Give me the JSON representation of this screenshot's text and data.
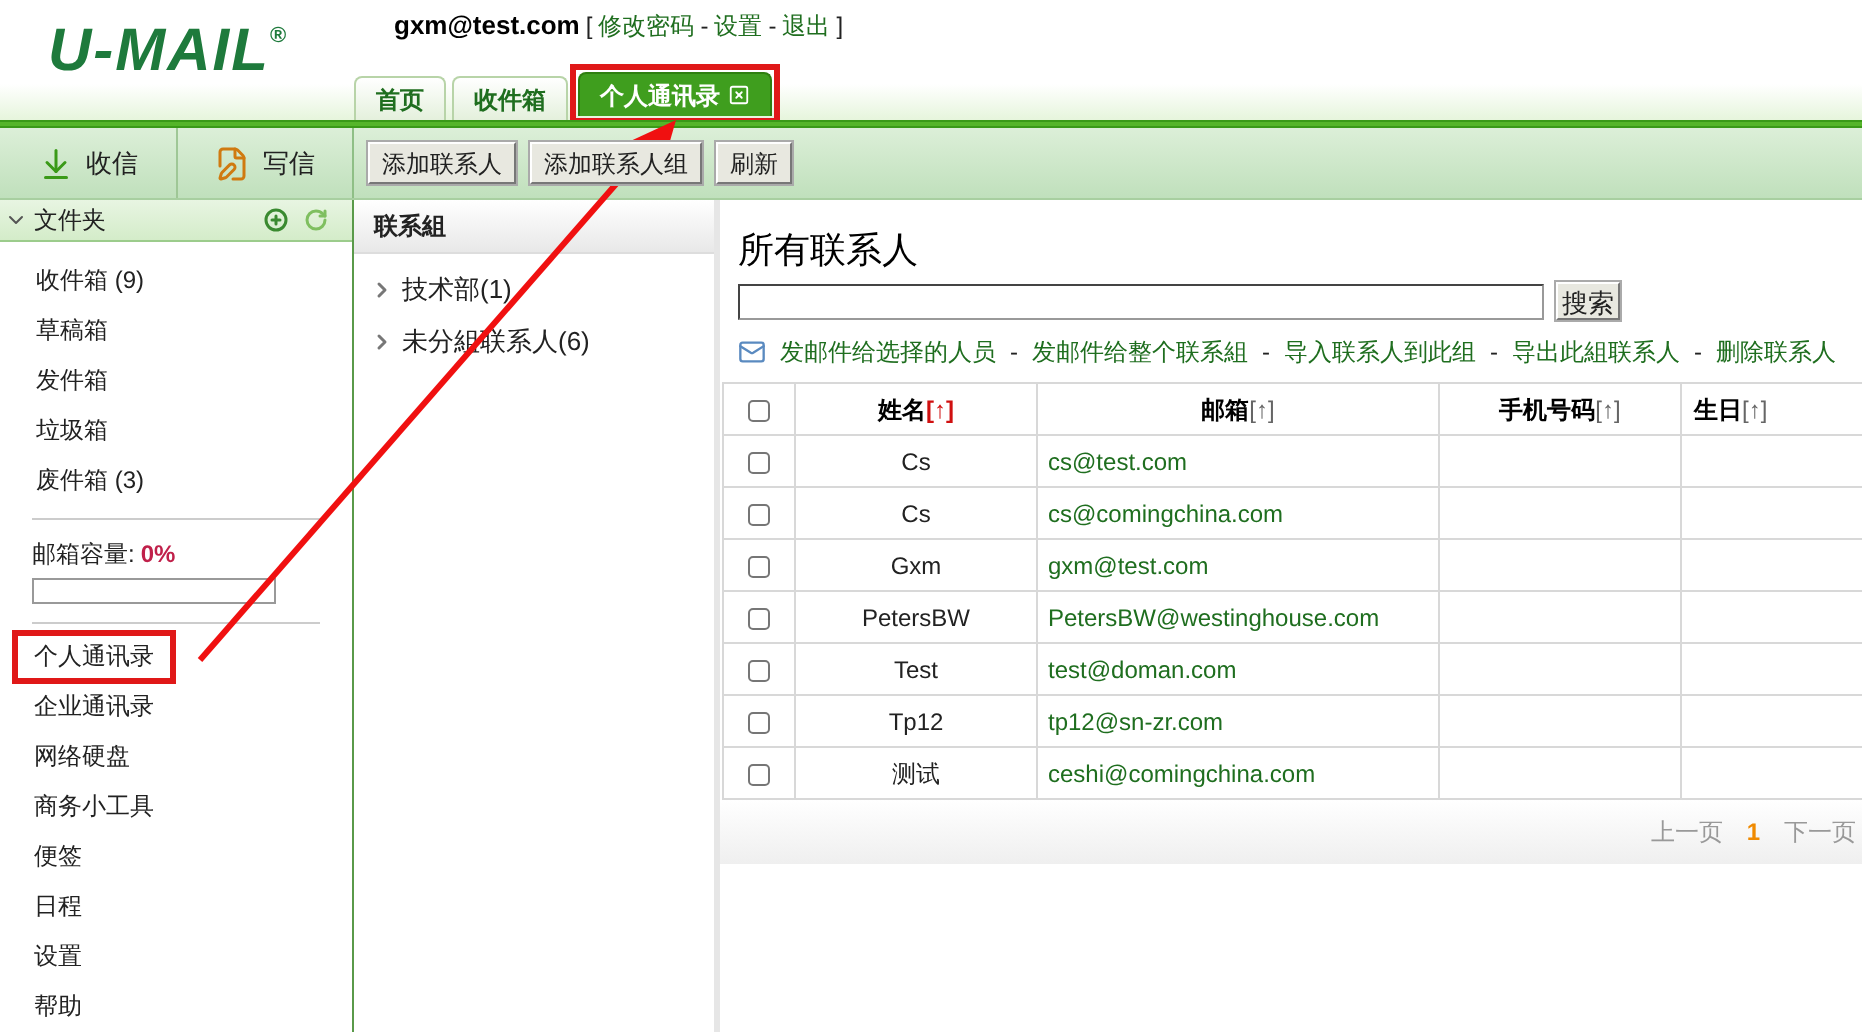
{
  "logo": {
    "text": "U-MAIL",
    "mark": "®"
  },
  "user_bar": [
    {
      "kind": "user",
      "text": "gxm@test.com"
    },
    {
      "kind": "punct",
      "text": "["
    },
    {
      "kind": "link",
      "text": "修改密码"
    },
    {
      "kind": "punct",
      "text": "-"
    },
    {
      "kind": "link",
      "text": "设置"
    },
    {
      "kind": "punct",
      "text": "-"
    },
    {
      "kind": "link",
      "text": "退出"
    },
    {
      "kind": "punct",
      "text": "]"
    }
  ],
  "tabs": [
    {
      "label": "首页",
      "selected": false,
      "closable": false,
      "highlighted": false
    },
    {
      "label": "收件箱",
      "selected": false,
      "closable": false,
      "highlighted": false
    },
    {
      "label": "个人通讯录",
      "selected": true,
      "closable": true,
      "highlighted": true
    }
  ],
  "mail_buttons": [
    {
      "kind": "receive",
      "label": "收信"
    },
    {
      "kind": "compose",
      "label": "写信"
    }
  ],
  "toolbar": [
    "添加联系人",
    "添加联系人组",
    "刷新"
  ],
  "sidebar": {
    "folder_title": "文件夹",
    "folders": [
      "收件箱 (9)",
      "草稿箱",
      "发件箱",
      "垃圾箱",
      "废件箱 (3)"
    ],
    "capacity_label": "邮箱容量:",
    "capacity_value": "0%",
    "level": 0,
    "items": [
      {
        "label": "个人通讯录",
        "highlighted": true
      },
      {
        "label": "企业通讯录",
        "highlighted": false
      },
      {
        "label": "网络硬盘",
        "highlighted": false
      },
      {
        "label": "商务小工具",
        "highlighted": false
      },
      {
        "label": "便签",
        "highlighted": false
      },
      {
        "label": "日程",
        "highlighted": false
      },
      {
        "label": "设置",
        "highlighted": false
      },
      {
        "label": "帮助",
        "highlighted": false
      }
    ]
  },
  "groups": {
    "title": "联系組",
    "items": [
      "技术部(1)",
      "未分組联系人(6)"
    ]
  },
  "main": {
    "title": "所有联系人",
    "search_button": "搜索",
    "actions": [
      {
        "kind": "link",
        "text": "发邮件给选择的人员"
      },
      {
        "kind": "sep",
        "text": "-"
      },
      {
        "kind": "link",
        "text": "发邮件给整个联系組"
      },
      {
        "kind": "sep",
        "text": "-"
      },
      {
        "kind": "link",
        "text": "导入联系人到此组"
      },
      {
        "kind": "sep",
        "text": "-"
      },
      {
        "kind": "link",
        "text": "导出此組联系人"
      },
      {
        "kind": "sep",
        "text": "-"
      },
      {
        "kind": "link",
        "text": "删除联系人"
      }
    ],
    "table": {
      "header_checked": false,
      "columns": [
        {
          "label": "姓名",
          "sort_mark": "[↑]",
          "sorted": true
        },
        {
          "label": "邮箱",
          "sort_mark": "[↑]",
          "sorted": false
        },
        {
          "label": "手机号码",
          "sort_mark": "[↑]",
          "sorted": false
        },
        {
          "label": "生日",
          "sort_mark": "[↑]",
          "sorted": false
        }
      ],
      "rows": [
        {
          "checked": false,
          "name": "Cs",
          "email": "cs@test.com"
        },
        {
          "checked": false,
          "name": "Cs",
          "email": "cs@comingchina.com"
        },
        {
          "checked": false,
          "name": "Gxm",
          "email": "gxm@test.com"
        },
        {
          "checked": false,
          "name": "PetersBW",
          "email": "PetersBW@westinghouse.com"
        },
        {
          "checked": false,
          "name": "Test",
          "email": "test@doman.com"
        },
        {
          "checked": false,
          "name": "Tp12",
          "email": "tp12@sn-zr.com"
        },
        {
          "checked": false,
          "name": "测试",
          "email": "ceshi@comingchina.com"
        }
      ]
    },
    "pagination": [
      {
        "kind": "prev",
        "text": "上一页"
      },
      {
        "kind": "current",
        "text": "1"
      },
      {
        "kind": "next",
        "text": "下一页"
      }
    ]
  }
}
